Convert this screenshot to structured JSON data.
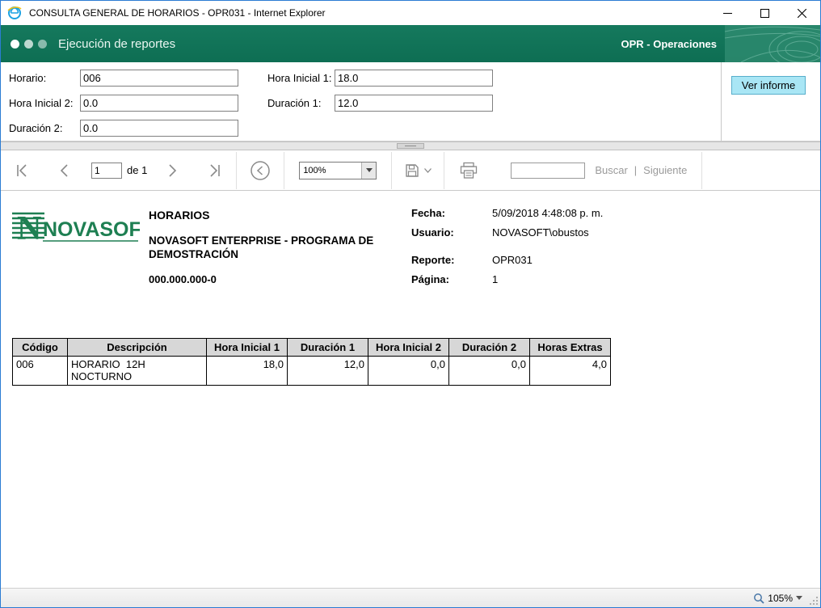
{
  "window": {
    "title": "CONSULTA GENERAL DE HORARIOS - OPR031 - Internet Explorer"
  },
  "banner": {
    "title": "Ejecución de reportes",
    "right": "OPR - Operaciones"
  },
  "form": {
    "horario": {
      "label": "Horario:",
      "value": "006"
    },
    "hora_inicial_1": {
      "label": "Hora Inicial 1:",
      "value": "18.0"
    },
    "hora_inicial_2": {
      "label": "Hora Inicial 2:",
      "value": "0.0"
    },
    "duracion_1": {
      "label": "Duración 1:",
      "value": "12.0"
    },
    "duracion_2": {
      "label": "Duración 2:",
      "value": "0.0"
    },
    "ver_informe": "Ver informe"
  },
  "toolbar": {
    "page": "1",
    "page_of": "de 1",
    "zoom": "100%",
    "search_value": "",
    "find_label": "Buscar",
    "find_sep": "|",
    "next_label": "Siguiente"
  },
  "report": {
    "logo": "NOVASOFT",
    "title": "HORARIOS",
    "subtitle": "NOVASOFT ENTERPRISE - PROGRAMA DE DEMOSTRACIÓN",
    "nit": "000.000.000-0",
    "fecha_label": "Fecha:",
    "fecha_value": "5/09/2018 4:48:08 p. m.",
    "usuario_label": "Usuario:",
    "usuario_value": "NOVASOFT\\obustos",
    "reporte_label": "Reporte:",
    "reporte_value": "OPR031",
    "pagina_label": "Página:",
    "pagina_value": "1",
    "table": {
      "headers": [
        "Código",
        "Descripción",
        "Hora Inicial 1",
        "Duración 1",
        "Hora Inicial 2",
        "Duración 2",
        "Horas Extras"
      ],
      "row": {
        "codigo": "006",
        "descripcion": "HORARIO  12H NOCTURNO",
        "hora_inicial_1": "18,0",
        "duracion_1": "12,0",
        "hora_inicial_2": "0,0",
        "duracion_2": "0,0",
        "horas_extras": "4,0"
      }
    }
  },
  "statusbar": {
    "zoom": "105%"
  },
  "colors": {
    "banner_green": "#15795d",
    "button_cyan": "#a9e6f5",
    "header_gray": "#d7d7d7"
  }
}
